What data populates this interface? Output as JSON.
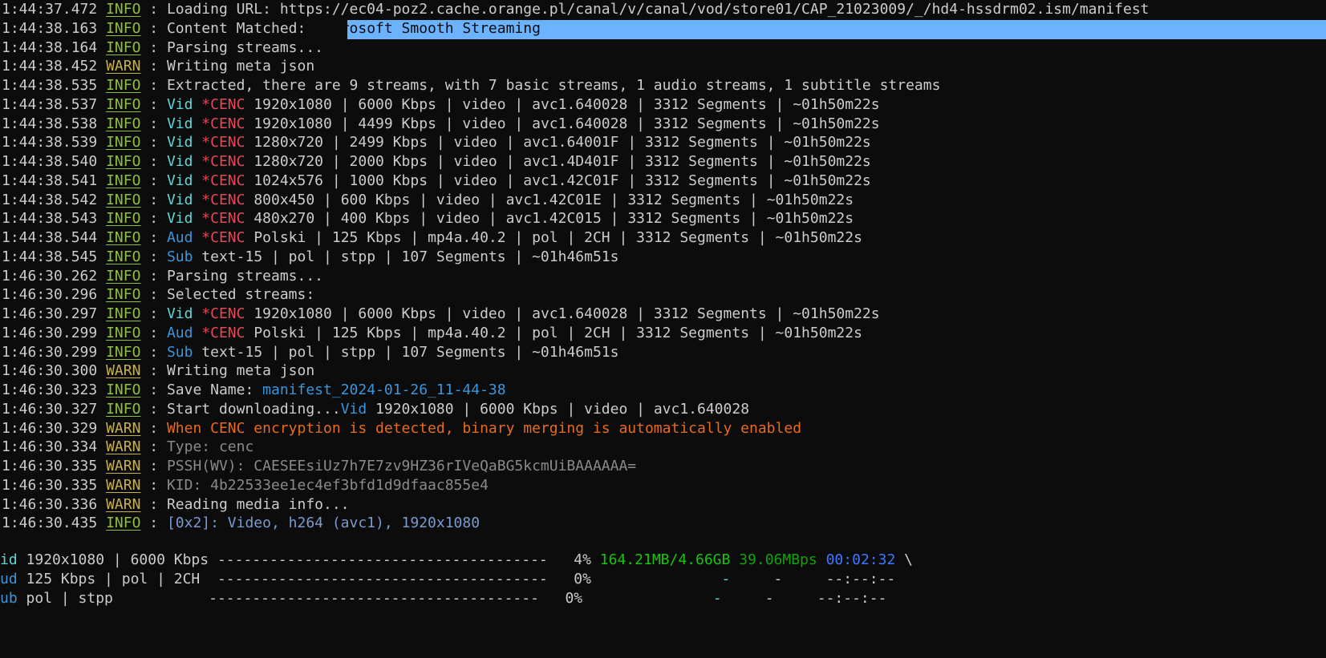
{
  "log": [
    {
      "time": "1:44:37.472",
      "level": "INFO",
      "parts": [
        {
          "t": "Loading URL: https://ec04-poz2.cache.orange.pl/canal/v/canal/vod/store01/CAP_21023009/_/hd4-hssdrm02.ism/manifest",
          "c": ""
        }
      ]
    },
    {
      "time": "1:44:38.163",
      "level": "INFO",
      "parts": [
        {
          "t": "Content Matched: ",
          "c": ""
        },
        {
          "t": "Microsoft Smooth Streaming",
          "c": "sel"
        }
      ]
    },
    {
      "time": "1:44:38.164",
      "level": "INFO",
      "parts": [
        {
          "t": "Parsing streams...",
          "c": ""
        }
      ]
    },
    {
      "time": "1:44:38.452",
      "level": "WARN",
      "parts": [
        {
          "t": "Writing meta json",
          "c": ""
        }
      ]
    },
    {
      "time": "1:44:38.535",
      "level": "INFO",
      "parts": [
        {
          "t": "Extracted, there are 9 streams, with 7 basic streams, 1 audio streams, 1 subtitle streams",
          "c": ""
        }
      ]
    },
    {
      "time": "1:44:38.537",
      "level": "INFO",
      "parts": [
        {
          "t": "Vid ",
          "c": "vid"
        },
        {
          "t": "*CENC ",
          "c": "cenc"
        },
        {
          "t": "1920x1080 | 6000 Kbps | video | avc1.640028 | 3312 Segments | ~01h50m22s",
          "c": ""
        }
      ]
    },
    {
      "time": "1:44:38.538",
      "level": "INFO",
      "parts": [
        {
          "t": "Vid ",
          "c": "vid"
        },
        {
          "t": "*CENC ",
          "c": "cenc"
        },
        {
          "t": "1920x1080 | 4499 Kbps | video | avc1.640028 | 3312 Segments | ~01h50m22s",
          "c": ""
        }
      ]
    },
    {
      "time": "1:44:38.539",
      "level": "INFO",
      "parts": [
        {
          "t": "Vid ",
          "c": "vid"
        },
        {
          "t": "*CENC ",
          "c": "cenc"
        },
        {
          "t": "1280x720 | 2499 Kbps | video | avc1.64001F | 3312 Segments | ~01h50m22s",
          "c": ""
        }
      ]
    },
    {
      "time": "1:44:38.540",
      "level": "INFO",
      "parts": [
        {
          "t": "Vid ",
          "c": "vid"
        },
        {
          "t": "*CENC ",
          "c": "cenc"
        },
        {
          "t": "1280x720 | 2000 Kbps | video | avc1.4D401F | 3312 Segments | ~01h50m22s",
          "c": ""
        }
      ]
    },
    {
      "time": "1:44:38.541",
      "level": "INFO",
      "parts": [
        {
          "t": "Vid ",
          "c": "vid"
        },
        {
          "t": "*CENC ",
          "c": "cenc"
        },
        {
          "t": "1024x576 | 1000 Kbps | video | avc1.42C01F | 3312 Segments | ~01h50m22s",
          "c": ""
        }
      ]
    },
    {
      "time": "1:44:38.542",
      "level": "INFO",
      "parts": [
        {
          "t": "Vid ",
          "c": "vid"
        },
        {
          "t": "*CENC ",
          "c": "cenc"
        },
        {
          "t": "800x450 | 600 Kbps | video | avc1.42C01E | 3312 Segments | ~01h50m22s",
          "c": ""
        }
      ]
    },
    {
      "time": "1:44:38.543",
      "level": "INFO",
      "parts": [
        {
          "t": "Vid ",
          "c": "vid"
        },
        {
          "t": "*CENC ",
          "c": "cenc"
        },
        {
          "t": "480x270 | 400 Kbps | video | avc1.42C015 | 3312 Segments | ~01h50m22s",
          "c": ""
        }
      ]
    },
    {
      "time": "1:44:38.544",
      "level": "INFO",
      "parts": [
        {
          "t": "Aud ",
          "c": "aud"
        },
        {
          "t": "*CENC ",
          "c": "cenc"
        },
        {
          "t": "Polski | 125 Kbps | mp4a.40.2 | pol | 2CH | 3312 Segments | ~01h50m22s",
          "c": ""
        }
      ]
    },
    {
      "time": "1:44:38.545",
      "level": "INFO",
      "parts": [
        {
          "t": "Sub ",
          "c": "aud"
        },
        {
          "t": "text-15 | pol | stpp | 107 Segments | ~01h46m51s",
          "c": ""
        }
      ]
    },
    {
      "time": "1:46:30.262",
      "level": "INFO",
      "parts": [
        {
          "t": "Parsing streams...",
          "c": ""
        }
      ]
    },
    {
      "time": "1:46:30.296",
      "level": "INFO",
      "parts": [
        {
          "t": "Selected streams:",
          "c": ""
        }
      ]
    },
    {
      "time": "1:46:30.297",
      "level": "INFO",
      "parts": [
        {
          "t": "Vid ",
          "c": "vid"
        },
        {
          "t": "*CENC ",
          "c": "cenc"
        },
        {
          "t": "1920x1080 | 6000 Kbps | video | avc1.640028 | 3312 Segments | ~01h50m22s",
          "c": ""
        }
      ]
    },
    {
      "time": "1:46:30.299",
      "level": "INFO",
      "parts": [
        {
          "t": "Aud ",
          "c": "aud"
        },
        {
          "t": "*CENC ",
          "c": "cenc"
        },
        {
          "t": "Polski | 125 Kbps | mp4a.40.2 | pol | 2CH | 3312 Segments | ~01h50m22s",
          "c": ""
        }
      ]
    },
    {
      "time": "1:46:30.299",
      "level": "INFO",
      "parts": [
        {
          "t": "Sub ",
          "c": "aud"
        },
        {
          "t": "text-15 | pol | stpp | 107 Segments | ~01h46m51s",
          "c": ""
        }
      ]
    },
    {
      "time": "1:46:30.300",
      "level": "WARN",
      "parts": [
        {
          "t": "Writing meta json",
          "c": ""
        }
      ]
    },
    {
      "time": "1:46:30.323",
      "level": "INFO",
      "parts": [
        {
          "t": "Save Name: ",
          "c": ""
        },
        {
          "t": "manifest_2024-01-26_11-44-38",
          "c": "file"
        }
      ]
    },
    {
      "time": "1:46:30.327",
      "level": "INFO",
      "parts": [
        {
          "t": "Start downloading...",
          "c": ""
        },
        {
          "t": "Vid ",
          "c": "aud"
        },
        {
          "t": "1920x1080 | 6000 Kbps | video | avc1.640028",
          "c": ""
        }
      ]
    },
    {
      "time": "1:46:30.329",
      "level": "WARN",
      "parts": [
        {
          "t": "When CENC encryption is detected, binary merging is automatically enabled",
          "c": "warnmsg"
        }
      ]
    },
    {
      "time": "1:46:30.334",
      "level": "WARN",
      "parts": [
        {
          "t": "Type: cenc",
          "c": "dim"
        }
      ]
    },
    {
      "time": "1:46:30.335",
      "level": "WARN",
      "parts": [
        {
          "t": "PSSH(WV): CAESEEsiUz7h7E7zv9HZ36rIVeQaBG5kcmUiBAAAAAA=",
          "c": "dim"
        }
      ]
    },
    {
      "time": "1:46:30.335",
      "level": "WARN",
      "parts": [
        {
          "t": "KID: 4b22533ee1ec4ef3bfd1d9dfaac855e4",
          "c": "dim"
        }
      ]
    },
    {
      "time": "1:46:30.336",
      "level": "WARN",
      "parts": [
        {
          "t": "Reading media info...",
          "c": ""
        }
      ]
    },
    {
      "time": "1:46:30.435",
      "level": "INFO",
      "parts": [
        {
          "t": "[0x2]: Video, h264 (avc1), 1920x1080",
          "c": "stream"
        }
      ]
    }
  ],
  "progress": [
    {
      "kind": "id",
      "desc": " 1920x1080 | 6000 Kbps ",
      "bar": "--------------------------------------",
      "percent": "4%",
      "size": "164.21MB/4.66GB",
      "speed": "39.06MBps",
      "eta": "00:02:32",
      "tail": " \\"
    },
    {
      "kind": "ud",
      "desc": " 125 Kbps | pol | 2CH  ",
      "bar": "--------------------------------------",
      "percent": "0%",
      "size": "-",
      "speed": "-",
      "eta": "--:--:--",
      "tail": ""
    },
    {
      "kind": "ub",
      "desc": " pol | stpp           ",
      "bar": "--------------------------------------",
      "percent": "0%",
      "size": "-",
      "speed": "-",
      "eta": "--:--:--",
      "tail": ""
    }
  ]
}
